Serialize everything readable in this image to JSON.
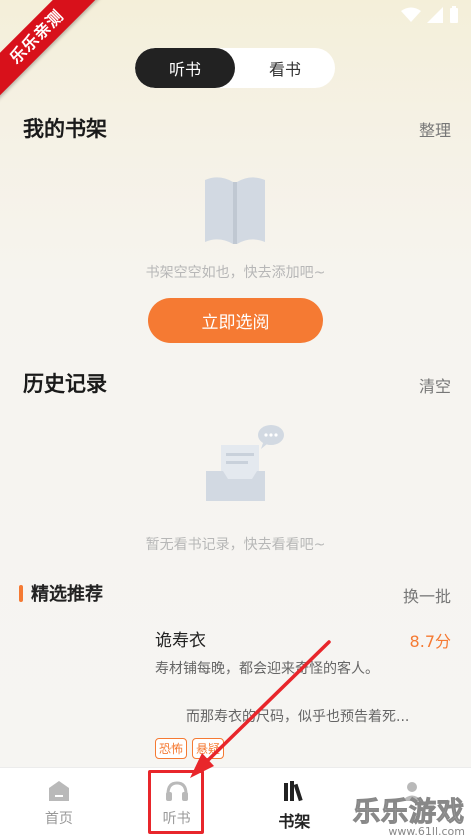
{
  "corner_ribbon": "乐乐亲测",
  "toggle": {
    "listen_tab": "听书",
    "read_tab": "看书",
    "active": "listen"
  },
  "bookshelf": {
    "title": "我的书架",
    "action": "整理",
    "empty_text": "书架空空如也，快去添加吧~",
    "button_label": "立即选阅"
  },
  "history": {
    "title": "历史记录",
    "action": "清空",
    "empty_text": "暂无看书记录，快去看看吧~"
  },
  "recommend": {
    "title": "精选推荐",
    "action": "换一批",
    "book": {
      "title": "诡寿衣",
      "score": "8.7分",
      "desc_line1": "寿材铺每晚，都会迎来奇怪的客人。",
      "desc_line2": "而那寿衣的尺码，似乎也预告着死...",
      "tags": [
        "恐怖",
        "悬疑"
      ]
    }
  },
  "bottom_nav": [
    {
      "label": "首页",
      "icon": "home-icon"
    },
    {
      "label": "听书",
      "icon": "headphones-icon"
    },
    {
      "label": "书架",
      "icon": "bookshelf-icon",
      "active": true
    },
    {
      "label": "",
      "icon": "profile-icon"
    }
  ],
  "watermark": {
    "main": "乐乐游戏",
    "sub": "www.61ll.com"
  },
  "colors": {
    "accent": "#f57a33",
    "highlight": "#e8262b",
    "ribbon": "#d8111b"
  }
}
